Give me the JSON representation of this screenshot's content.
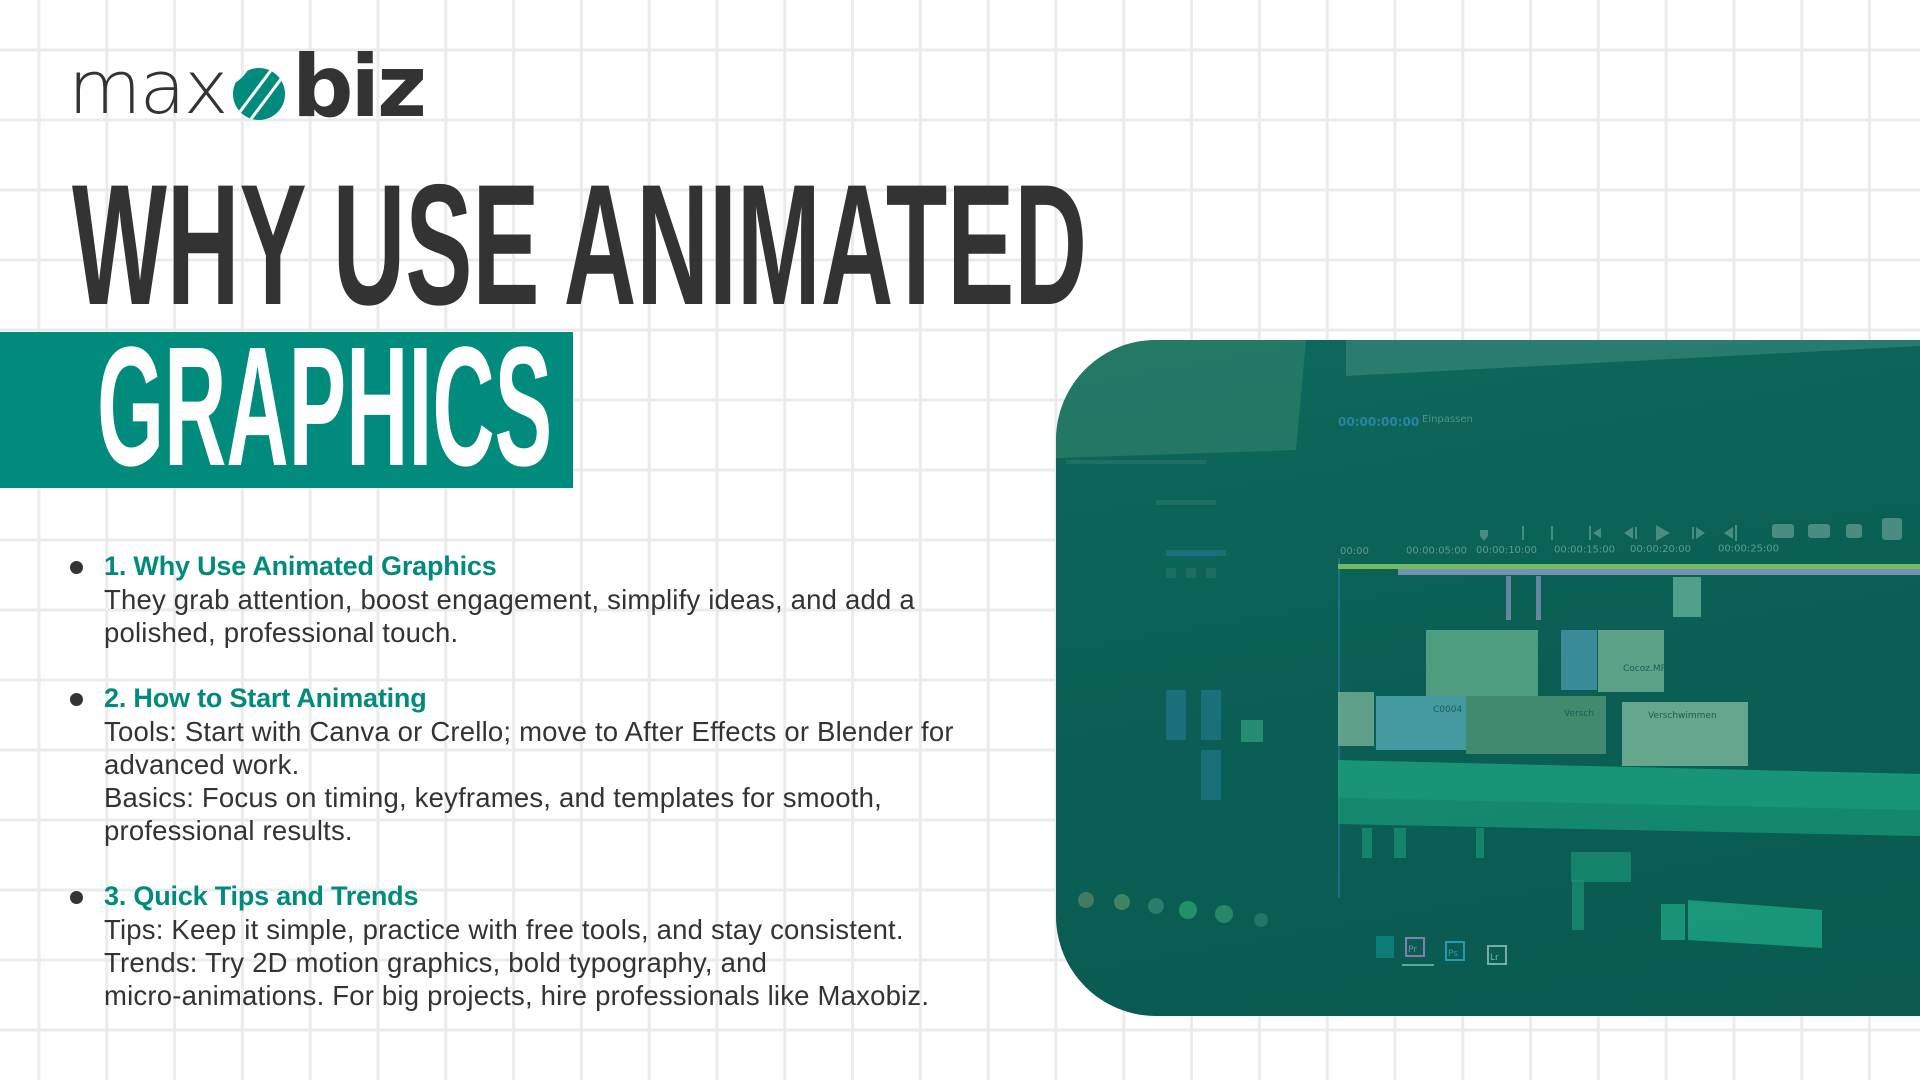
{
  "brand": {
    "logo_light": "max",
    "logo_bold": "biz",
    "accent_color": "#008b7d",
    "text_color": "#333333",
    "panel_color": "#0b5e55"
  },
  "headline": {
    "line1": "WHY USE ANIMATED",
    "line2": "GRAPHICS"
  },
  "sections": [
    {
      "heading": "1. Why Use Animated Graphics",
      "lines": [
        "They grab attention, boost engagement, simplify ideas, and add a",
        "polished, professional touch."
      ]
    },
    {
      "heading": "2. How to Start Animating",
      "lines": [
        "Tools: Start with Canva or Crello; move to After Effects or Blender for",
        "advanced work.",
        "Basics: Focus on timing, keyframes, and templates for smooth,",
        "professional results."
      ]
    },
    {
      "heading": "3. Quick Tips and Trends",
      "lines": [
        "Tips: Keep it simple, practice with free tools, and stay consistent.",
        "Trends: Try 2D motion graphics, bold typography, and",
        "micro-animations. For big projects, hire professionals like Maxobiz."
      ]
    }
  ],
  "photo": {
    "description": "video editing timeline on a monitor, teal-tinted",
    "timecode": "00:00:00:00",
    "fit_menu": "Einpassen",
    "ruler_ticks": [
      "00:00",
      "00:00:05:00",
      "00:00:10:00",
      "00:00:15:00",
      "00:00:20:00",
      "00:00:25:00"
    ],
    "clip_labels": [
      "Cocoz.MP",
      "Verschwimmen",
      "Versch",
      "C0004"
    ],
    "dock_apps": [
      "Pr",
      "Ps",
      "Lr"
    ]
  }
}
